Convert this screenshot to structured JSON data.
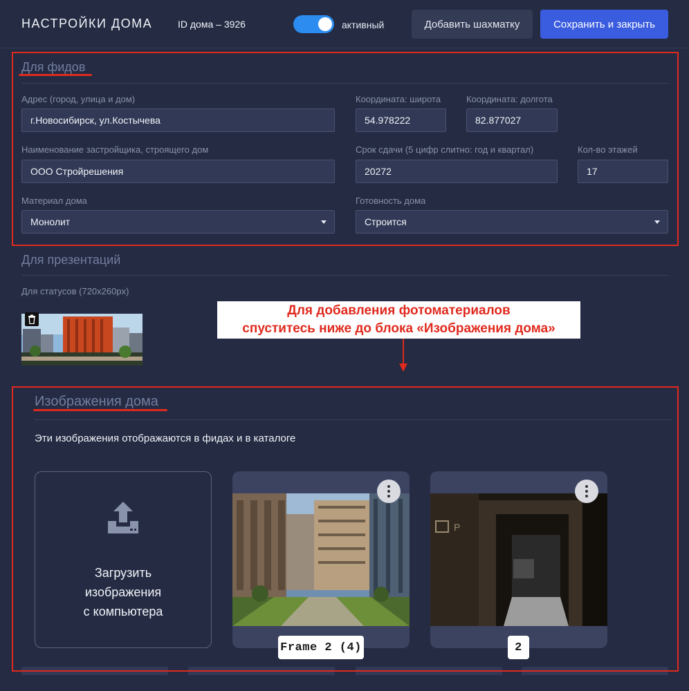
{
  "header": {
    "title": "НАСТРОЙКИ ДОМА",
    "house_id": "ID дома – 3926",
    "toggle_label": "активный",
    "add_board_button": "Добавить шахматку",
    "save_button": "Сохранить и закрыть"
  },
  "feeds": {
    "heading": "Для фидов",
    "address_label": "Адрес (город, улица и дом)",
    "address_value": "г.Новосибирск, ул.Костычева",
    "lat_label": "Координата: широта",
    "lat_value": "54.978222",
    "lon_label": "Координата: долгота",
    "lon_value": "82.877027",
    "developer_label": "Наименование застройщика, строящего дом",
    "developer_value": "ООО Стройрешения",
    "deadline_label": "Срок сдачи (5 цифр слитно: год и квартал)",
    "deadline_value": "20272",
    "floors_label": "Кол-во этажей",
    "floors_value": "17",
    "material_label": "Материал дома",
    "material_value": "Монолит",
    "readiness_label": "Готовность дома",
    "readiness_value": "Строится"
  },
  "presentations": {
    "heading": "Для презентаций",
    "status_label": "Для статусов (720x260px)"
  },
  "callout": {
    "line1": "Для добавления фотоматериалов",
    "line2": "спуститесь ниже до блока «Изображения дома»"
  },
  "images": {
    "heading": "Изображения дома",
    "description": "Эти изображения отображаются в фидах и в каталоге",
    "upload_text": "Загрузить\nизображения\nс компьютера",
    "cards": [
      {
        "caption": "Frame 2 (4)"
      },
      {
        "caption": "2"
      }
    ]
  },
  "colors": {
    "accent": "#3a5de0",
    "annotation": "#e02a1e",
    "background": "#242b43"
  }
}
